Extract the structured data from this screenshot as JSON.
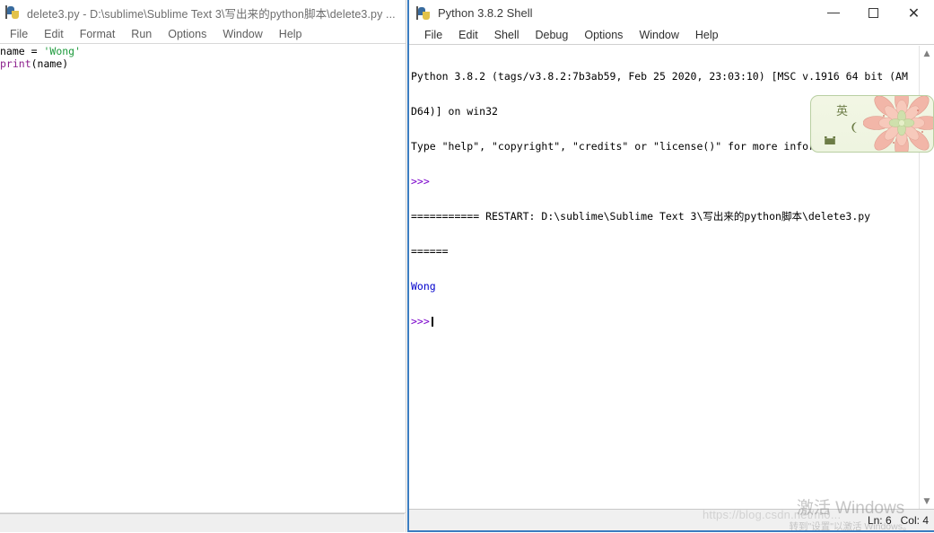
{
  "editor_window": {
    "icon": "python-file-icon",
    "title": "delete3.py - D:\\sublime\\Sublime Text 3\\写出来的python脚本\\delete3.py ...",
    "menu": [
      {
        "label": "File"
      },
      {
        "label": "Edit"
      },
      {
        "label": "Format"
      },
      {
        "label": "Run"
      },
      {
        "label": "Options"
      },
      {
        "label": "Window"
      },
      {
        "label": "Help"
      }
    ],
    "code": {
      "line1_a": "name = ",
      "line1_b": "'Wong'",
      "line2_a": "print",
      "line2_b": "(name)"
    }
  },
  "shell_window": {
    "icon": "python-shell-icon",
    "title": "Python 3.8.2 Shell",
    "window_controls": {
      "minimize": "minimize-button",
      "maximize": "maximize-button",
      "close": "close-button"
    },
    "menu": [
      {
        "label": "File"
      },
      {
        "label": "Edit"
      },
      {
        "label": "Shell"
      },
      {
        "label": "Debug"
      },
      {
        "label": "Options"
      },
      {
        "label": "Window"
      },
      {
        "label": "Help"
      }
    ],
    "output": {
      "banner_line1": "Python 3.8.2 (tags/v3.8.2:7b3ab59, Feb 25 2020, 23:03:10) [MSC v.1916 64 bit (AM",
      "banner_line2": "D64)] on win32",
      "banner_line3": "Type \"help\", \"copyright\", \"credits\" or \"license()\" for more information.",
      "prompt1": ">>>",
      "restart_line1": "=========== RESTART: D:\\sublime\\Sublime Text 3\\写出来的python脚本\\delete3.py ",
      "restart_line2": "======",
      "result": "Wong",
      "prompt2": ">>>"
    },
    "scrollbar": {
      "up_arrow": "scroll-up-arrow",
      "down_arrow": "scroll-down-arrow"
    },
    "statusbar": {
      "position": "Ln: 6   Col: 4"
    }
  },
  "ime_bar": {
    "language_mode": "英",
    "moon_icon": "moon-icon",
    "keyboard_icon": "keyboard-icon",
    "decoration": "succulent-flower-illustration"
  },
  "watermarks": {
    "activation_line1": "激活 Windows",
    "activation_line2": "转到\"设置\"以激活 Windows。",
    "url": "https://blog.csdn.net/m0..."
  },
  "colors": {
    "string_green": "#1d9a3c",
    "builtin_purple": "#8c1f8c",
    "prompt_purple": "#7a00cc",
    "output_blue": "#0000cc",
    "window_border_blue": "#3a7cc0",
    "ime_border": "#b9cfa2"
  }
}
